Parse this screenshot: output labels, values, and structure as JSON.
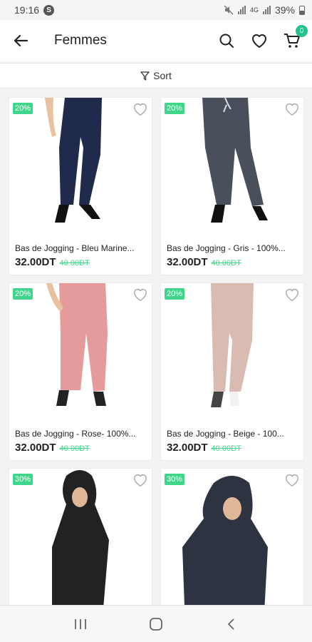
{
  "status_bar": {
    "time": "19:16",
    "notif_badge": "S",
    "battery": "39%",
    "net": "4G"
  },
  "app_bar": {
    "title": "Femmes",
    "cart_count": "0"
  },
  "sort": {
    "label": "Sort"
  },
  "products": [
    {
      "discount": "20%",
      "name": "Bas de Jogging - Bleu Marine...",
      "price": "32.00DT",
      "old_price": "40.00DT",
      "color": "#1f2a4d"
    },
    {
      "discount": "20%",
      "name": "Bas de Jogging - Gris - 100%...",
      "price": "32.00DT",
      "old_price": "40.00DT",
      "color": "#4a4f5c"
    },
    {
      "discount": "20%",
      "name": "Bas de Jogging - Rose- 100%...",
      "price": "32.00DT",
      "old_price": "40.00DT",
      "color": "#e59a9c"
    },
    {
      "discount": "20%",
      "name": "Bas de Jogging - Beige - 100...",
      "price": "32.00DT",
      "old_price": "40.00DT",
      "color": "#d9bbb1"
    },
    {
      "discount": "30%",
      "color": "#222222"
    },
    {
      "discount": "30%",
      "color": "#2d3340"
    }
  ]
}
